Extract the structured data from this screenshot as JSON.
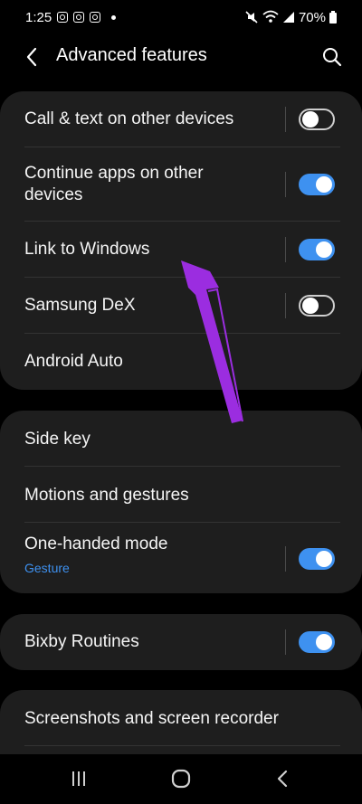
{
  "status_bar": {
    "time": "1:25",
    "battery": "70%"
  },
  "header": {
    "title": "Advanced features"
  },
  "group1": [
    {
      "label": "Call & text on other devices",
      "toggle": false
    },
    {
      "label": "Continue apps on other devices",
      "toggle": true
    },
    {
      "label": "Link to Windows",
      "toggle": true
    },
    {
      "label": "Samsung DeX",
      "toggle": false
    },
    {
      "label": "Android Auto"
    }
  ],
  "group2": [
    {
      "label": "Side key"
    },
    {
      "label": "Motions and gestures"
    },
    {
      "label": "One-handed mode",
      "sublabel": "Gesture",
      "toggle": true
    }
  ],
  "group3": [
    {
      "label": "Bixby Routines",
      "toggle": true
    }
  ],
  "group4": [
    {
      "label": "Screenshots and screen recorder"
    }
  ],
  "colors": {
    "accent": "#3e91f0",
    "card": "#1e1e1e",
    "background": "#000000",
    "annotation_arrow": "#9b2de0"
  },
  "icons": {
    "back": "chevron-left-icon",
    "search": "search-icon",
    "nav_recents": "recents-icon",
    "nav_home": "home-icon",
    "nav_back": "back-icon"
  }
}
